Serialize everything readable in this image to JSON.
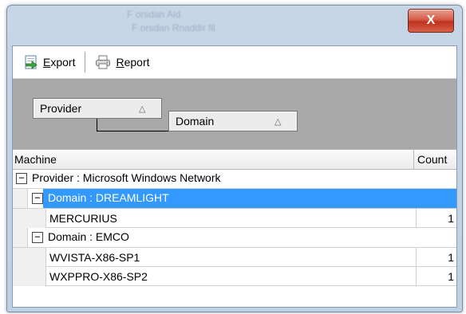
{
  "window": {
    "background_text_1": "F orsdan Ald",
    "background_text_2": "F orsdan Rnaddir fil",
    "close_label": "X"
  },
  "toolbar": {
    "export_label": "Export",
    "report_label": "Report",
    "export_icon": "export-icon",
    "report_icon": "printer-icon"
  },
  "group_panel": {
    "chips": [
      {
        "label": "Provider",
        "sort": "ascending"
      },
      {
        "label": "Domain",
        "sort": "ascending"
      }
    ],
    "arrow_glyph": "△"
  },
  "grid": {
    "columns": {
      "machine": "Machine",
      "count": "Count"
    },
    "expander_glyph": "−",
    "provider_group": "Provider : Microsoft Windows Network",
    "domains": [
      {
        "label": "Domain : DREAMLIGHT",
        "selected": true,
        "rows": [
          {
            "machine": "MERCURIUS",
            "count": "1"
          }
        ]
      },
      {
        "label": "Domain : EMCO",
        "selected": false,
        "rows": [
          {
            "machine": "WVISTA-X86-SP1",
            "count": "1"
          },
          {
            "machine": "WXPPRO-X86-SP2",
            "count": "1"
          }
        ]
      }
    ]
  },
  "colors": {
    "selection": "#3399ff",
    "group_panel": "#a9a9a9",
    "close_button": "#c0321e"
  }
}
